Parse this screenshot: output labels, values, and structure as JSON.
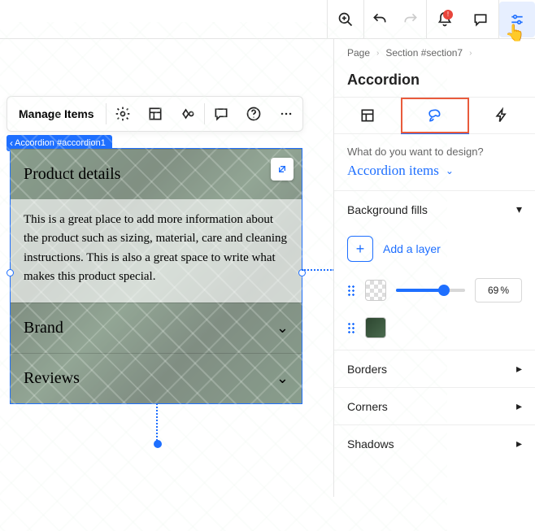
{
  "topbar": {
    "alert_badge": "!"
  },
  "toolbar": {
    "manage_items": "Manage Items"
  },
  "selection_chip": "Accordion #accordion1",
  "accordion": {
    "items": [
      {
        "title": "Product details",
        "expanded": true,
        "body": "This is a great place to add more information about the product such as sizing, material, care and cleaning instructions. This is also a great space to write what makes this product special."
      },
      {
        "title": "Brand",
        "expanded": false
      },
      {
        "title": "Reviews",
        "expanded": false
      }
    ]
  },
  "panel": {
    "breadcrumb": [
      "Page",
      "Section #section7"
    ],
    "title": "Accordion",
    "prompt": "What do you want to design?",
    "segment": "Accordion items",
    "sections": {
      "background_fills": "Background fills",
      "add_layer": "Add a layer",
      "opacity_value": "69",
      "opacity_unit": "%",
      "borders": "Borders",
      "corners": "Corners",
      "shadows": "Shadows"
    }
  }
}
